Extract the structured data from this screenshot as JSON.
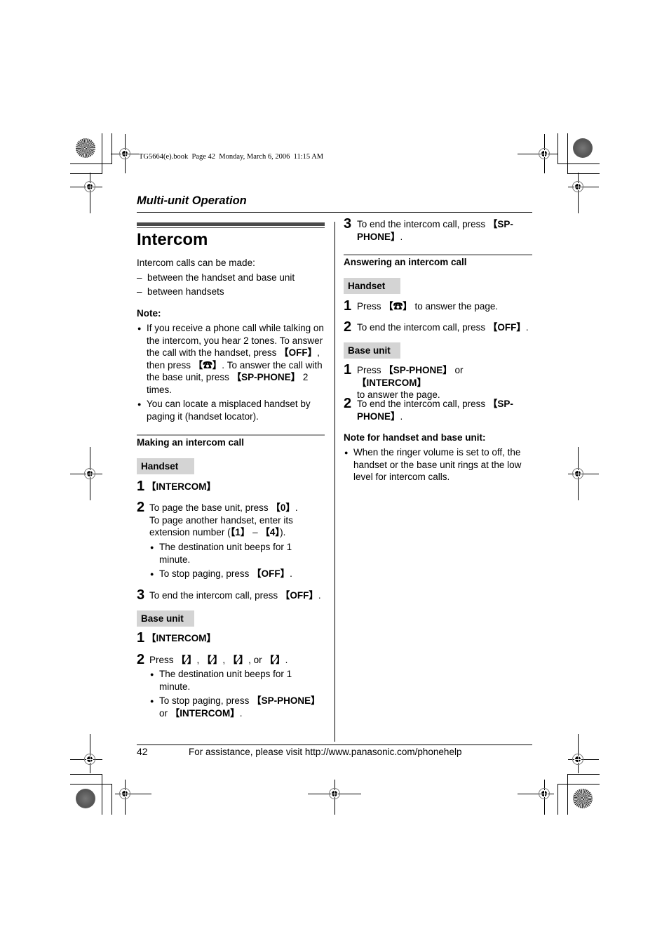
{
  "print_header": "TG5664(e).book  Page 42  Monday, March 6, 2006  11:15 AM",
  "section_title": "Multi-unit Operation",
  "page_title": "Intercom",
  "intro": {
    "lead": "Intercom calls can be made:",
    "items": [
      "between the handset and base unit",
      "between handsets"
    ]
  },
  "note": {
    "heading": "Note:",
    "bullets": [
      {
        "parts": [
          "If you receive a phone call while talking on the intercom, you hear 2 tones. To answer the call with the handset, press ",
          "【OFF】",
          ", then press ",
          "【talk-icon】",
          ". To answer the call with the base unit, press ",
          "【SP-PHONE】",
          " 2 times."
        ]
      },
      {
        "text": "You can locate a misplaced handset by paging it (handset locator)."
      }
    ]
  },
  "making": {
    "heading": "Making an intercom call",
    "handset": {
      "label": "Handset",
      "steps": [
        {
          "num": "1",
          "key": "【INTERCOM】"
        },
        {
          "num": "2",
          "line1a": "To page the base unit, press ",
          "line1key": "【0】",
          "line1b": ".",
          "line2": "To page another handset, enter its",
          "line3a": "extension number (",
          "line3key1": "【1】",
          "line3mid": " – ",
          "line3key2": "【4】",
          "line3b": ").",
          "bullets": [
            {
              "text": "The destination unit beeps for 1 minute."
            },
            {
              "pre": "To stop paging, press ",
              "key": "【OFF】",
              "post": "."
            }
          ]
        },
        {
          "num": "3",
          "pre": "To end the intercom call, press ",
          "key": "【OFF】",
          "post": "."
        }
      ]
    },
    "base": {
      "label": "Base unit",
      "steps": [
        {
          "num": "1",
          "key": "【INTERCOM】"
        },
        {
          "num": "2",
          "pre": "Press ",
          "post": ", or ",
          "end": ".",
          "bullets": [
            {
              "text": "The destination unit beeps for 1 minute."
            },
            {
              "pre": "To stop paging, press ",
              "key": "【SP-PHONE】",
              "mid": "or ",
              "key2": "【INTERCOM】",
              "post": "."
            }
          ]
        }
      ]
    }
  },
  "continued_step3": {
    "num": "3",
    "pre": "To end the intercom call, press ",
    "key1": "【SP-",
    "key2": "PHONE】",
    "post": "."
  },
  "answering": {
    "heading": "Answering an intercom call",
    "handset": {
      "label": "Handset",
      "steps": [
        {
          "num": "1",
          "pre": "Press ",
          "post": " to answer the page."
        },
        {
          "num": "2",
          "pre": "To end the intercom call, press ",
          "key": "【OFF】",
          "post": "."
        }
      ]
    },
    "base": {
      "label": "Base unit",
      "steps": [
        {
          "num": "1",
          "pre": "Press ",
          "key1": "【SP-PHONE】",
          "mid": " or ",
          "key2": "【INTERCOM】",
          "line2": "to answer the page."
        },
        {
          "num": "2",
          "pre": "To end the intercom call, press ",
          "key1": "【SP-",
          "key2": "PHONE】",
          "post": "."
        }
      ]
    },
    "note": {
      "heading": "Note for handset and base unit:",
      "text": "When the ringer volume is set to off, the handset or the base unit rings at the low level for intercom calls."
    }
  },
  "footer": {
    "page_number": "42",
    "text": "For assistance, please visit http://www.panasonic.com/phonehelp"
  }
}
